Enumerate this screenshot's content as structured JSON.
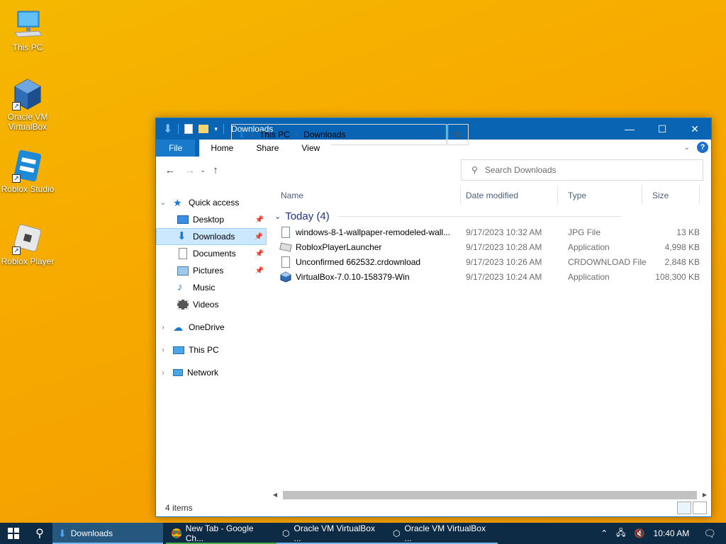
{
  "desktop": {
    "icons": [
      {
        "label": "This PC"
      },
      {
        "label": "Oracle VM VirtualBox"
      },
      {
        "label": "Roblox Studio"
      },
      {
        "label": "Roblox Player"
      }
    ]
  },
  "window": {
    "title": "Downloads",
    "tabs": {
      "file": "File",
      "home": "Home",
      "share": "Share",
      "view": "View"
    },
    "address": {
      "segment1": "This PC",
      "segment2": "Downloads"
    },
    "search": {
      "placeholder": "Search Downloads"
    },
    "nav": {
      "quick_access": "Quick access",
      "desktop": "Desktop",
      "downloads": "Downloads",
      "documents": "Documents",
      "pictures": "Pictures",
      "music": "Music",
      "videos": "Videos",
      "onedrive": "OneDrive",
      "this_pc": "This PC",
      "network": "Network"
    },
    "columns": {
      "name": "Name",
      "date": "Date modified",
      "type": "Type",
      "size": "Size"
    },
    "group": {
      "label": "Today (4)"
    },
    "files": [
      {
        "name": "windows-8-1-wallpaper-remodeled-wall...",
        "date": "9/17/2023 10:32 AM",
        "type": "JPG File",
        "size": "13 KB",
        "icon": "image-file-icon"
      },
      {
        "name": "RobloxPlayerLauncher",
        "date": "9/17/2023 10:28 AM",
        "type": "Application",
        "size": "4,998 KB",
        "icon": "roblox-app-icon"
      },
      {
        "name": "Unconfirmed 662532.crdownload",
        "date": "9/17/2023 10:26 AM",
        "type": "CRDOWNLOAD File",
        "size": "2,848 KB",
        "icon": "blank-file-icon"
      },
      {
        "name": "VirtualBox-7.0.10-158379-Win",
        "date": "9/17/2023 10:24 AM",
        "type": "Application",
        "size": "108,300 KB",
        "icon": "virtualbox-app-icon"
      }
    ],
    "status": {
      "items": "4 items"
    }
  },
  "taskbar": {
    "items": [
      {
        "label": "Downloads"
      },
      {
        "label": "New Tab - Google Ch..."
      },
      {
        "label": "Oracle VM VirtualBox ..."
      },
      {
        "label": "Oracle VM VirtualBox ..."
      }
    ],
    "clock": "10:40 AM"
  },
  "colors": {
    "accent": "#0a64b4",
    "selection": "#cce8ff",
    "taskbar": "#0d2b45"
  }
}
